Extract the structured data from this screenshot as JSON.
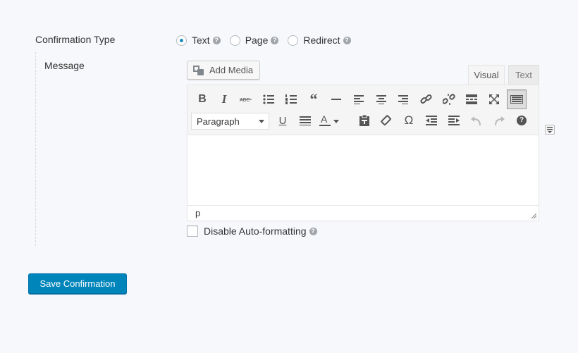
{
  "form": {
    "confirmation_type_label": "Confirmation Type",
    "message_label": "Message",
    "radio_options": [
      {
        "label": "Text",
        "checked": true
      },
      {
        "label": "Page",
        "checked": false
      },
      {
        "label": "Redirect",
        "checked": false
      }
    ],
    "help_glyph": "?"
  },
  "editor": {
    "add_media_label": "Add Media",
    "tab_visual": "Visual",
    "tab_text": "Text",
    "format_select_value": "Paragraph",
    "status_path": "p",
    "toolbar_row1_icons": [
      "bold-icon",
      "italic-icon",
      "strikethrough-icon",
      "bullet-list-icon",
      "numbered-list-icon",
      "blockquote-icon",
      "horizontal-line-icon",
      "align-left-icon",
      "align-center-icon",
      "align-right-icon",
      "link-icon",
      "unlink-icon",
      "read-more-icon",
      "fullscreen-icon",
      "toolbar-toggle-icon"
    ],
    "toolbar_row2_icons": [
      "underline-icon",
      "justify-icon",
      "text-color-icon",
      "paste-as-text-icon",
      "clear-formatting-icon",
      "special-character-icon",
      "outdent-icon",
      "indent-icon",
      "undo-icon",
      "redo-icon",
      "help-icon"
    ]
  },
  "disable_autoformat_label": "Disable Auto-formatting",
  "save_button_label": "Save Confirmation",
  "colors": {
    "primary_button": "#0085ba",
    "radio_checked": "#1e8cbe",
    "page_bg": "#f6f8fb"
  }
}
